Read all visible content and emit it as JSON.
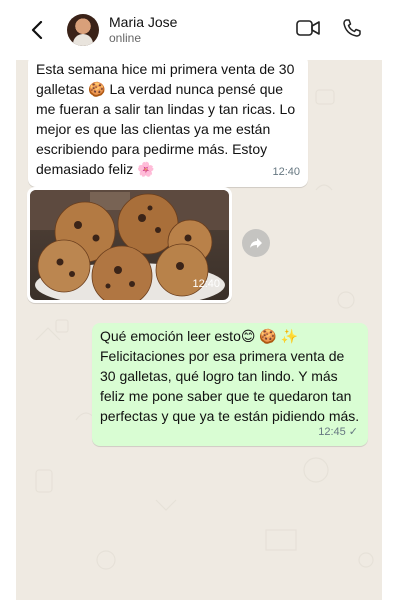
{
  "header": {
    "contact_name": "Maria Jose",
    "contact_status": "online"
  },
  "messages": [
    {
      "direction": "incoming",
      "text": "Esta semana hice mi primera venta de 30 galletas 🍪 La verdad nunca pensé que me fueran a salir tan lindas y tan ricas. Lo mejor es que las clientas ya me están escribiendo para pedirme más. Estoy demasiado feliz 🌸",
      "time": "12:40"
    },
    {
      "direction": "incoming",
      "type": "image",
      "image_subject": "cookies",
      "time": "12:40"
    },
    {
      "direction": "outgoing",
      "text": "Qué emoción leer esto😊 🍪 ✨ Felicitaciones por esa primera venta de 30 galletas, qué logro tan lindo. Y más feliz me pone saber que te quedaron tan perfectas y que ya te están pidiendo más.",
      "time": "12:45",
      "status_icon": "single-check-icon"
    }
  ],
  "colors": {
    "chat_background": "#efeae2",
    "incoming_bubble": "#ffffff",
    "outgoing_bubble": "#d9fdd3",
    "meta_text": "#667781"
  }
}
